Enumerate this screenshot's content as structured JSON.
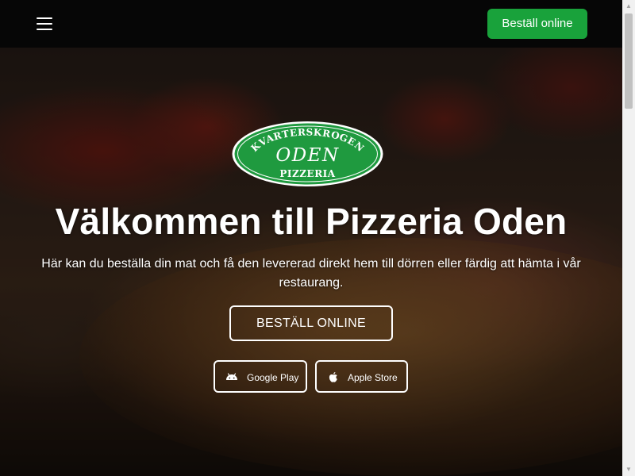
{
  "navbar": {
    "menu_icon": "hamburger-menu-icon",
    "order_button_label": "Beställ online",
    "order_button_color": "#19a23b",
    "background_color": "#060606"
  },
  "logo": {
    "top_text": "KVARTERSKROGEN",
    "middle_text": "ODEN",
    "bottom_text": "PIZZERIA",
    "color": "#1f9a3f"
  },
  "hero": {
    "title": "Välkommen till Pizzeria Oden",
    "subtitle": "Här kan du beställa din mat och få den levererad direkt hem till dörren eller färdig att hämta i vår restaurang.",
    "cta_label": "BESTÄLL ONLINE",
    "store_buttons": [
      {
        "label": "Google Play",
        "icon": "android-icon"
      },
      {
        "label": "Apple Store",
        "icon": "apple-icon"
      }
    ]
  },
  "scrollbar": {
    "up_arrow": "▲",
    "down_arrow": "▼"
  }
}
